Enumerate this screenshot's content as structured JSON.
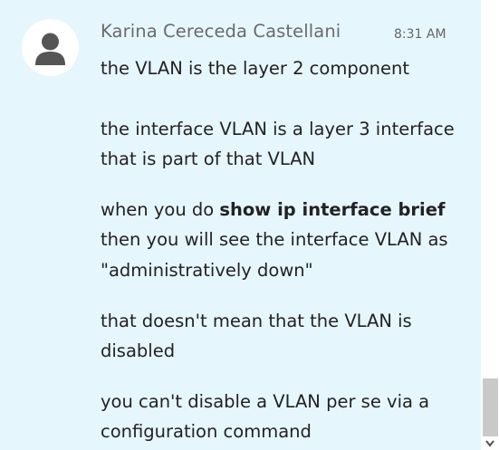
{
  "message": {
    "author": "Karina Cereceda Castellani",
    "timestamp": "8:31 AM",
    "paragraphs": [
      {
        "text": "the VLAN is the layer 2 component"
      },
      {
        "text": "the interface VLAN is a layer 3 interface that is part of that VLAN"
      },
      {
        "prefix": "when you do ",
        "bold": "show ip interface brief",
        "suffix": " then you will see the interface VLAN as \"administratively down\""
      },
      {
        "text": "that doesn't mean that the VLAN is disabled"
      },
      {
        "text": "you can't disable a VLAN per se via a configuration command"
      }
    ]
  },
  "icons": {
    "avatar": "user-silhouette-icon",
    "scroll_down": "chevron-down-icon"
  },
  "colors": {
    "chat_background": "#e6f6fd",
    "avatar_fill": "#555555",
    "scrollbar_thumb": "#c9c9c9"
  }
}
